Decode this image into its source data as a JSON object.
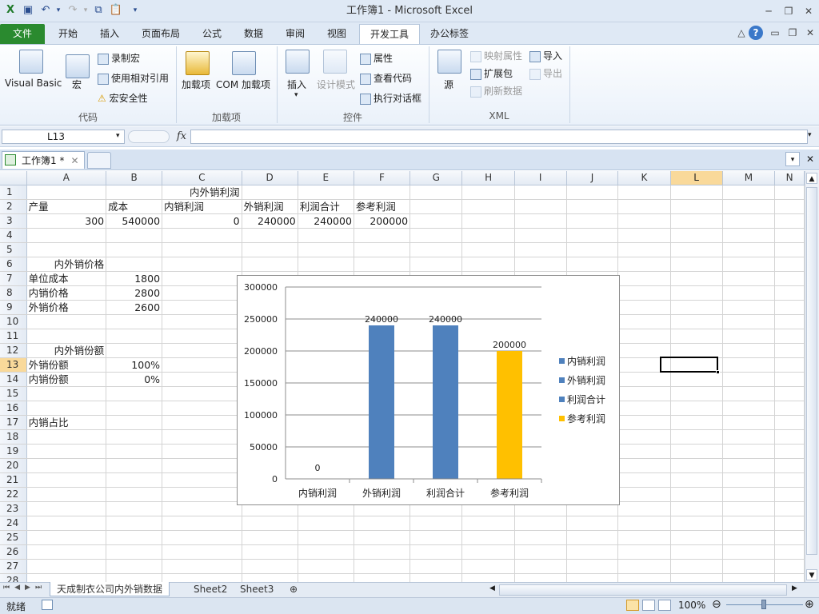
{
  "window": {
    "title": "工作簿1 - Microsoft Excel"
  },
  "ribbon_tabs": [
    {
      "label": "文件"
    },
    {
      "label": "开始"
    },
    {
      "label": "插入"
    },
    {
      "label": "页面布局"
    },
    {
      "label": "公式"
    },
    {
      "label": "数据"
    },
    {
      "label": "审阅"
    },
    {
      "label": "视图"
    },
    {
      "label": "开发工具"
    },
    {
      "label": "办公标签"
    }
  ],
  "ribbon": {
    "code": {
      "label": "代码",
      "visual_basic": "Visual Basic",
      "macro": "宏",
      "record_macro": "录制宏",
      "relative_ref": "使用相对引用",
      "macro_security": "宏安全性"
    },
    "addins": {
      "label": "加载项",
      "addins": "加载项",
      "com_addins": "COM 加载项"
    },
    "controls": {
      "label": "控件",
      "insert": "插入",
      "design_mode": "设计模式",
      "properties": "属性",
      "view_code": "查看代码",
      "run_dialog": "执行对话框"
    },
    "xml": {
      "label": "XML",
      "source": "源",
      "map_props": "映射属性",
      "expansion": "扩展包",
      "refresh": "刷新数据",
      "import": "导入",
      "export": "导出"
    }
  },
  "formula_bar": {
    "name_box": "L13",
    "fx": "fx",
    "value": ""
  },
  "workbook_tab": {
    "label": "工作簿1 *"
  },
  "columns": [
    "A",
    "B",
    "C",
    "D",
    "E",
    "F",
    "G",
    "H",
    "I",
    "J",
    "K",
    "L",
    "M",
    "N"
  ],
  "rows": [
    "1",
    "2",
    "3",
    "4",
    "5",
    "6",
    "7",
    "8",
    "9",
    "10",
    "11",
    "12",
    "13",
    "14",
    "15",
    "16",
    "17",
    "18",
    "19",
    "20",
    "21",
    "22",
    "23",
    "24",
    "25",
    "26",
    "27",
    "28"
  ],
  "cells": {
    "C1": "内外销利润",
    "A2": "产量",
    "B2": "成本",
    "C2": "内销利润",
    "D2": "外销利润",
    "E2": "利润合计",
    "F2": "参考利润",
    "A3": "300",
    "B3": "540000",
    "C3": "0",
    "D3": "240000",
    "E3": "240000",
    "F3": "200000",
    "A6": "内外销价格",
    "A7": "单位成本",
    "B7": "1800",
    "A8": "内销价格",
    "B8": "2800",
    "A9": "外销价格",
    "B9": "2600",
    "A12": "内外销份额",
    "A13": "外销份额",
    "B13": "100%",
    "A14": "内销份额",
    "B14": "0%",
    "A17": "内销占比"
  },
  "chart_data": {
    "type": "bar",
    "categories": [
      "内销利润",
      "外销利润",
      "利润合计",
      "参考利润"
    ],
    "values": [
      0,
      240000,
      240000,
      200000
    ],
    "colors": [
      "#4f81bd",
      "#4f81bd",
      "#4f81bd",
      "#ffc000"
    ],
    "legend": [
      "内销利润",
      "外销利润",
      "利润合计",
      "参考利润"
    ],
    "legend_position": "right",
    "yticks": [
      "300000",
      "250000",
      "200000",
      "150000",
      "100000",
      "50000",
      "0"
    ],
    "ylim": [
      0,
      300000
    ],
    "grid": true,
    "data_labels": [
      "0",
      "240000",
      "240000",
      "200000"
    ]
  },
  "sheets": [
    {
      "label": "天成制衣公司内外销数据",
      "active": true
    },
    {
      "label": "Sheet2"
    },
    {
      "label": "Sheet3"
    }
  ],
  "status": {
    "ready": "就绪",
    "zoom": "100%"
  },
  "colors": {
    "file_tab": "#2a8a2f",
    "bar_blue": "#4f81bd",
    "bar_gold": "#ffc000",
    "selected_header": "#f9d99a"
  }
}
